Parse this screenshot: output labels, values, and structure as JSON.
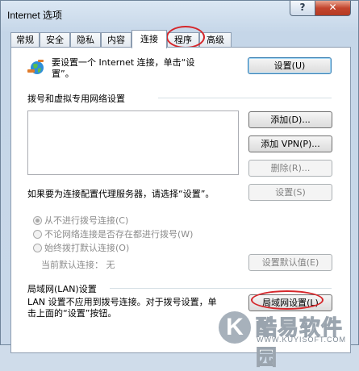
{
  "window": {
    "title": "Internet 选项",
    "help": "?",
    "close": "✕"
  },
  "tabs": [
    {
      "label": "常规"
    },
    {
      "label": "安全"
    },
    {
      "label": "隐私"
    },
    {
      "label": "内容"
    },
    {
      "label": "连接",
      "active": true
    },
    {
      "label": "程序"
    },
    {
      "label": "高级"
    }
  ],
  "setup": {
    "text_line1": "要设置一个 Internet 连接，单击“设",
    "text_line2": "置”。",
    "button": "设置(U)"
  },
  "dialup": {
    "section_title": "拨号和虚拟专用网络设置",
    "add_button": "添加(D)...",
    "add_vpn_button": "添加 VPN(P)...",
    "delete_button": "删除(R)...",
    "proxy_text": "如果要为连接配置代理服务器，请选择“设置”。",
    "settings_button": "设置(S)",
    "radio_never": "从不进行拨号连接(C)",
    "radio_no_network": "不论网络连接是否存在都进行拨号(W)",
    "radio_always": "始终拨打默认连接(O)",
    "current_default_label": "当前默认连接：",
    "current_default_value": "无",
    "set_default_button": "设置默认值(E)"
  },
  "lan": {
    "section_title": "局域网(LAN)设置",
    "text_line1": "LAN 设置不应用到拨号连接。对于拨号设置，单",
    "text_line2": "击上面的“设置”按钮。",
    "button": "局域网设置(L)"
  },
  "watermark": {
    "logo_letter": "K",
    "name": "酷易软件园",
    "url": "WWW.KUYISOFT.COM"
  }
}
